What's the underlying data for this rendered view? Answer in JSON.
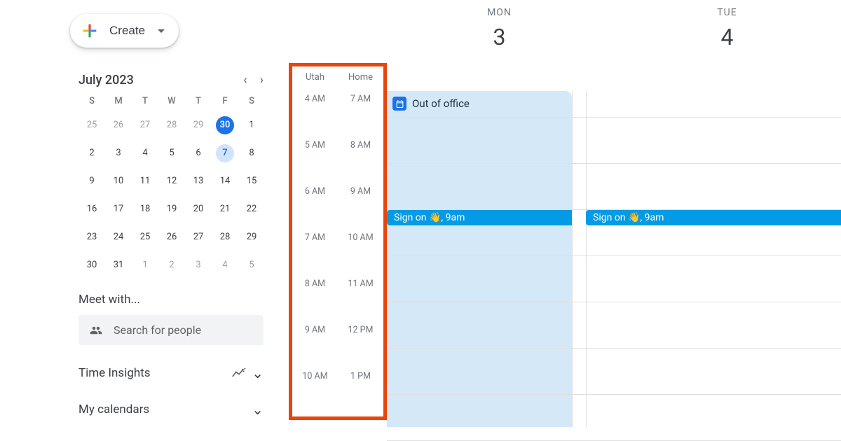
{
  "create": {
    "label": "Create"
  },
  "miniCal": {
    "title": "July 2023",
    "dows": [
      "S",
      "M",
      "T",
      "W",
      "T",
      "F",
      "S"
    ],
    "rows": [
      [
        {
          "n": "25",
          "m": true
        },
        {
          "n": "26",
          "m": true
        },
        {
          "n": "27",
          "m": true
        },
        {
          "n": "28",
          "m": true
        },
        {
          "n": "29",
          "m": true
        },
        {
          "n": "30",
          "today": true
        },
        {
          "n": "1"
        }
      ],
      [
        {
          "n": "2"
        },
        {
          "n": "3"
        },
        {
          "n": "4"
        },
        {
          "n": "5"
        },
        {
          "n": "6"
        },
        {
          "n": "7",
          "sel": true
        },
        {
          "n": "8"
        }
      ],
      [
        {
          "n": "9"
        },
        {
          "n": "10"
        },
        {
          "n": "11"
        },
        {
          "n": "12"
        },
        {
          "n": "13"
        },
        {
          "n": "14"
        },
        {
          "n": "15"
        }
      ],
      [
        {
          "n": "16"
        },
        {
          "n": "17"
        },
        {
          "n": "18"
        },
        {
          "n": "19"
        },
        {
          "n": "20"
        },
        {
          "n": "21"
        },
        {
          "n": "22"
        }
      ],
      [
        {
          "n": "23"
        },
        {
          "n": "24"
        },
        {
          "n": "25"
        },
        {
          "n": "26"
        },
        {
          "n": "27"
        },
        {
          "n": "28"
        },
        {
          "n": "29"
        }
      ],
      [
        {
          "n": "30"
        },
        {
          "n": "31"
        },
        {
          "n": "1",
          "m": true
        },
        {
          "n": "2",
          "m": true
        },
        {
          "n": "3",
          "m": true
        },
        {
          "n": "4",
          "m": true
        },
        {
          "n": "5",
          "m": true
        }
      ]
    ]
  },
  "meetWith": {
    "title": "Meet with...",
    "placeholder": "Search for people"
  },
  "timeInsights": {
    "label": "Time Insights"
  },
  "myCalendars": {
    "label": "My calendars"
  },
  "dayHeaders": [
    {
      "dow": "MON",
      "num": "3"
    },
    {
      "dow": "TUE",
      "num": "4"
    }
  ],
  "timezones": {
    "labels": [
      "Utah",
      "Home"
    ],
    "rows": [
      [
        "4 AM",
        "7 AM"
      ],
      [
        "5 AM",
        "8 AM"
      ],
      [
        "6 AM",
        "9 AM"
      ],
      [
        "7 AM",
        "10 AM"
      ],
      [
        "8 AM",
        "11 AM"
      ],
      [
        "9 AM",
        "12 PM"
      ],
      [
        "10 AM",
        "1 PM"
      ]
    ]
  },
  "events": {
    "ooo": "Out of office",
    "signOn": "Sign on 👋, 9am"
  }
}
